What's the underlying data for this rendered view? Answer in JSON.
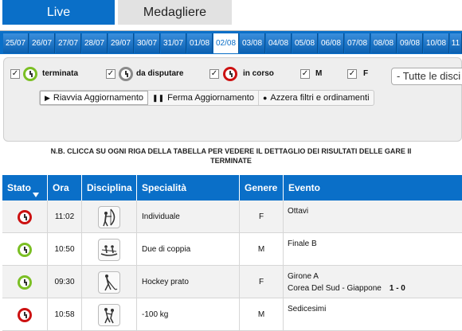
{
  "nav": {
    "live": "Live",
    "medagliere": "Medagliere"
  },
  "dates": [
    "25/07",
    "26/07",
    "27/07",
    "28/07",
    "29/07",
    "30/07",
    "31/07",
    "01/08",
    "02/08",
    "03/08",
    "04/08",
    "05/08",
    "06/08",
    "07/08",
    "08/08",
    "09/08",
    "10/08",
    "11"
  ],
  "active_date": "02/08",
  "filters": {
    "terminata": "terminata",
    "da_disputare": "da disputare",
    "in_corso": "in corso",
    "m": "M",
    "f": "F",
    "dropdown": "- Tutte le disci",
    "check": "✓"
  },
  "buttons": {
    "riavvia": "Riavvia Aggiornamento",
    "ferma": "Ferma Aggiornamento",
    "azzera": "Azzera filtri e ordinamenti"
  },
  "note": {
    "line1": "N.B. CLICCA SU OGNI RIGA DELLA TABELLA PER VEDERE IL DETTAGLIO DEI RISULTATI DELLE GARE II",
    "line2": "TERMINATE"
  },
  "columns": {
    "stato": "Stato",
    "ora": "Ora",
    "disciplina": "Disciplina",
    "specialita": "Specialità",
    "genere": "Genere",
    "evento": "Evento"
  },
  "rows": [
    {
      "status": "red",
      "ora": "11:02",
      "specialita": "Individuale",
      "genere": "F",
      "evento": "Ottavi",
      "sub": "",
      "score": ""
    },
    {
      "status": "green",
      "ora": "10:50",
      "specialita": "Due di coppia",
      "genere": "M",
      "evento": "Finale B",
      "sub": "",
      "score": ""
    },
    {
      "status": "green",
      "ora": "09:30",
      "specialita": "Hockey prato",
      "genere": "F",
      "evento": "Girone A",
      "sub": "Corea Del Sud - Giappone",
      "score": "1 - 0"
    },
    {
      "status": "red",
      "ora": "10:58",
      "specialita": "-100 kg",
      "genere": "M",
      "evento": "Sedicesimi",
      "sub": "",
      "score": ""
    }
  ],
  "colors": {
    "brand_blue": "#0a6fc8",
    "green": "#7bbf24",
    "red": "#cc1111",
    "grey": "#8a8a8a"
  }
}
